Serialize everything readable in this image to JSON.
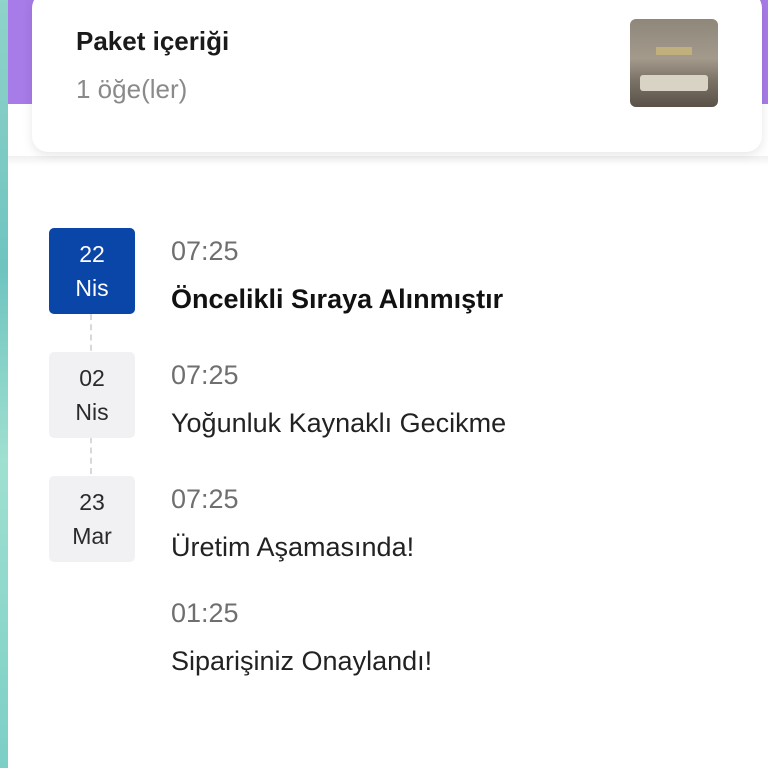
{
  "package": {
    "title": "Paket içeriği",
    "count": "1 öğe(ler)",
    "thumbnail_icon": "product-thumbnail"
  },
  "timeline": [
    {
      "day": "22",
      "month": "Nis",
      "time": "07:25",
      "status": "Öncelikli Sıraya Alınmıştır",
      "active": true
    },
    {
      "day": "02",
      "month": "Nis",
      "time": "07:25",
      "status": "Yoğunluk Kaynaklı Gecikme",
      "active": false
    },
    {
      "day": "23",
      "month": "Mar",
      "time": "07:25",
      "status": "Üretim Aşamasında!",
      "active": false
    },
    {
      "time": "01:25",
      "status": "Siparişiniz Onaylandı!",
      "active": false
    }
  ],
  "colors": {
    "header_purple": "#a77be8",
    "active_badge": "#0a45a8",
    "inactive_badge": "#f1f1f3"
  }
}
